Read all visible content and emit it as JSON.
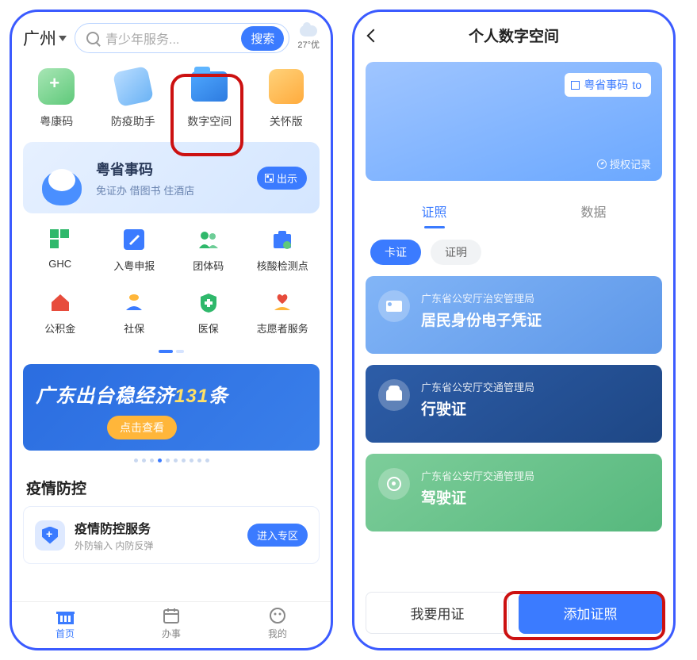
{
  "left": {
    "city": "广州",
    "search_placeholder": "青少年服务...",
    "search_button": "搜索",
    "weather": "27°优",
    "quick_items": [
      {
        "label": "粤康码"
      },
      {
        "label": "防疫助手"
      },
      {
        "label": "数字空间"
      },
      {
        "label": "关怀版"
      }
    ],
    "banner": {
      "title": "粤省事码",
      "subtitle": "免证办 借图书 住酒店",
      "button": "出示"
    },
    "grid": [
      {
        "label": "GHC"
      },
      {
        "label": "入粤申报"
      },
      {
        "label": "团体码"
      },
      {
        "label": "核酸检测点"
      },
      {
        "label": "公积金"
      },
      {
        "label": "社保"
      },
      {
        "label": "医保"
      },
      {
        "label": "志愿者服务"
      }
    ],
    "promo": {
      "title_pre": "广东出台稳经济",
      "title_num": "131",
      "title_post": "条",
      "button": "点击查看"
    },
    "section_title": "疫情防控",
    "service": {
      "title": "疫情防控服务",
      "subtitle": "外防输入 内防反弹",
      "button": "进入专区"
    },
    "tabs": [
      {
        "label": "首页",
        "active": true
      },
      {
        "label": "办事",
        "active": false
      },
      {
        "label": "我的",
        "active": false
      }
    ]
  },
  "right": {
    "title": "个人数字空间",
    "hero_badge": "粤省事码",
    "hero_auth": "授权记录",
    "tabs": [
      {
        "label": "证照",
        "active": true
      },
      {
        "label": "数据",
        "active": false
      }
    ],
    "chips": [
      {
        "label": "卡证",
        "active": true
      },
      {
        "label": "证明",
        "active": false
      }
    ],
    "certs": [
      {
        "dept": "广东省公安厅治安管理局",
        "name": "居民身份电子凭证"
      },
      {
        "dept": "广东省公安厅交通管理局",
        "name": "行驶证"
      },
      {
        "dept": "广东省公安厅交通管理局",
        "name": "驾驶证"
      }
    ],
    "actions": {
      "use": "我要用证",
      "add": "添加证照"
    }
  }
}
